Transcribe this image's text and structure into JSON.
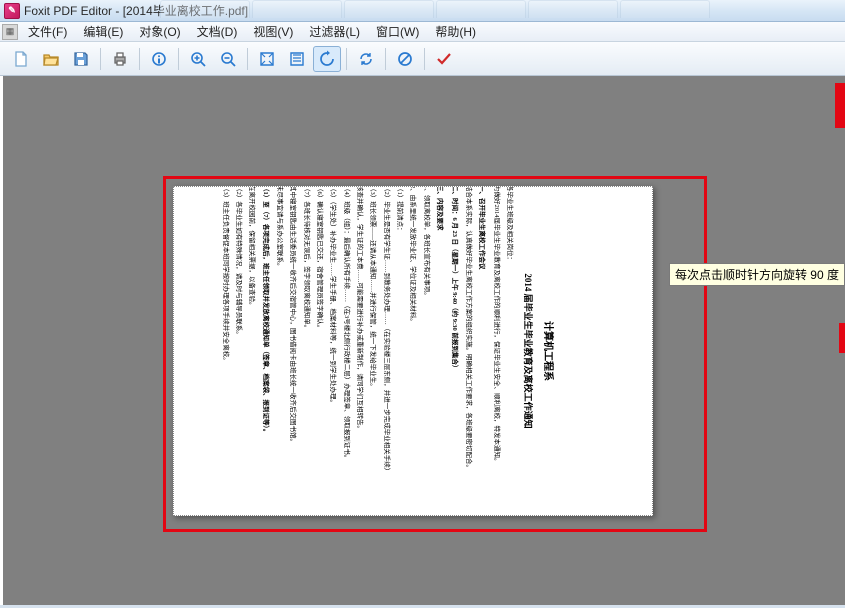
{
  "titlebar": {
    "app_name": "Foxit PDF Editor",
    "doc_name": "[2014毕业离校工作.pdf]"
  },
  "ghost_tabs": [
    "",
    "",
    "",
    "",
    "",
    ""
  ],
  "menubar": {
    "items": [
      {
        "label": "文件(F)"
      },
      {
        "label": "编辑(E)"
      },
      {
        "label": "对象(O)"
      },
      {
        "label": "文档(D)"
      },
      {
        "label": "视图(V)"
      },
      {
        "label": "过滤器(L)"
      },
      {
        "label": "窗口(W)"
      },
      {
        "label": "帮助(H)"
      }
    ]
  },
  "toolbar": {
    "buttons": [
      {
        "name": "new-file",
        "icon": "file-blank",
        "hl": "#bfe3ff"
      },
      {
        "name": "open-file",
        "icon": "folder-open",
        "hl": "#f5c464"
      },
      {
        "name": "save-file",
        "icon": "floppy",
        "hl": "#6aa0d8"
      },
      {
        "sep": true
      },
      {
        "name": "print",
        "icon": "printer",
        "hl": "#888"
      },
      {
        "sep": true
      },
      {
        "name": "info",
        "icon": "info",
        "hl": "#2a7ad0"
      },
      {
        "sep": true
      },
      {
        "name": "zoom-in",
        "icon": "zoom-in",
        "hl": "#2a7ad0"
      },
      {
        "name": "zoom-out",
        "icon": "zoom-out",
        "hl": "#2a7ad0"
      },
      {
        "sep": true
      },
      {
        "name": "fit-page",
        "icon": "fit",
        "hl": "#2a7ad0"
      },
      {
        "name": "fit-width",
        "icon": "fitw",
        "hl": "#2a7ad0"
      },
      {
        "name": "rotate",
        "icon": "rotate",
        "hl": "#2a7ad0",
        "active": true
      },
      {
        "sep": true
      },
      {
        "name": "refresh",
        "icon": "refresh",
        "hl": "#2a7ad0"
      },
      {
        "sep": true
      },
      {
        "name": "forbidden",
        "icon": "forbidden",
        "hl": "#2a7ad0"
      },
      {
        "sep": true
      },
      {
        "name": "check",
        "icon": "check",
        "hl": "#d02a2a"
      }
    ]
  },
  "tooltip": "每次点击顺时针方向旋转 90 度",
  "document": {
    "department": "计算机工程系",
    "title": "2014 届毕业生毕业教育及离校工作通知",
    "lines": [
      {
        "cls": "para",
        "text": "各毕业生班级及相关岗位："
      },
      {
        "cls": "para",
        "text": "为做好2014届毕业生毕业教育及离校工作的顺利进行，保证毕业生安全、顺利离校，特发本通知。"
      },
      {
        "cls": "para sect",
        "text": "一、召开毕业生离校工作会议"
      },
      {
        "cls": "para",
        "text": "结合本系实际，认真做好毕业生离校工作方案的组织实施。明确相关工作要求，各班级要密切配合。"
      },
      {
        "cls": "para sect",
        "text": "二、时间：6 月 23 日（星期一）上午 9:40（约 9:30 前报到集合）"
      },
      {
        "cls": "para sect",
        "text": "三、内容及要求"
      },
      {
        "cls": "para",
        "text": "1、领取离校单，各班长宣布有关事项。"
      },
      {
        "cls": "para",
        "text": "2、由系里统一发放毕业证、学位证及相关材料。"
      },
      {
        "cls": "para",
        "text": "（1）提前清点："
      },
      {
        "cls": "para",
        "text": "（2）毕业生是否有学生证……到教务处办理……（在实验楼三层东侧，并进一步完成毕业相关手续）"
      },
      {
        "cls": "para",
        "text": "（3）班长领票——还请从本通知……并进行保管，统一下发给毕业生。"
      },
      {
        "cls": "para",
        "text": "核查并确认，学生证的工本费……可能需要进行补办或重新制作，请同学们互相转告。"
      },
      {
        "cls": "para",
        "text": "（4）班级（组）：最后确认所有手续……（在3号楼北侧行政楼二层）办理签章、领取报到证书。"
      },
      {
        "cls": "para",
        "text": "（5）（学生处）补办毕业生……学生手册、档案材料等，统一到学生处办理。"
      },
      {
        "cls": "para",
        "text": "（6）确认寝室钥匙已交还，宿舍管理员签字确认。"
      },
      {
        "cls": "para",
        "text": "（7）各班长待核对无误后，签字领取离校通知单。"
      },
      {
        "cls": "para",
        "text": "其中寝室钥匙由生活委员统一收齐后交宿管中心，图书借阅卡由班长统一收齐后交图书馆。"
      },
      {
        "cls": "para",
        "text": "未尽事宜请与系办公室联系。"
      },
      {
        "cls": "para sect",
        "text": "（1）至（7）各项完成后，班主任领取并发放离校通知单（签章、档案袋、报到证等）。"
      },
      {
        "cls": "para",
        "text": "在离开校园前，保留相关票据，以备查验。"
      },
      {
        "cls": "para",
        "text": "（2）各毕业生如有特殊情况，请及时与辅导员联系。"
      },
      {
        "cls": "para",
        "text": "（3）班主任负责督促本班同学按时办理各项手续并安全离校。"
      }
    ]
  }
}
